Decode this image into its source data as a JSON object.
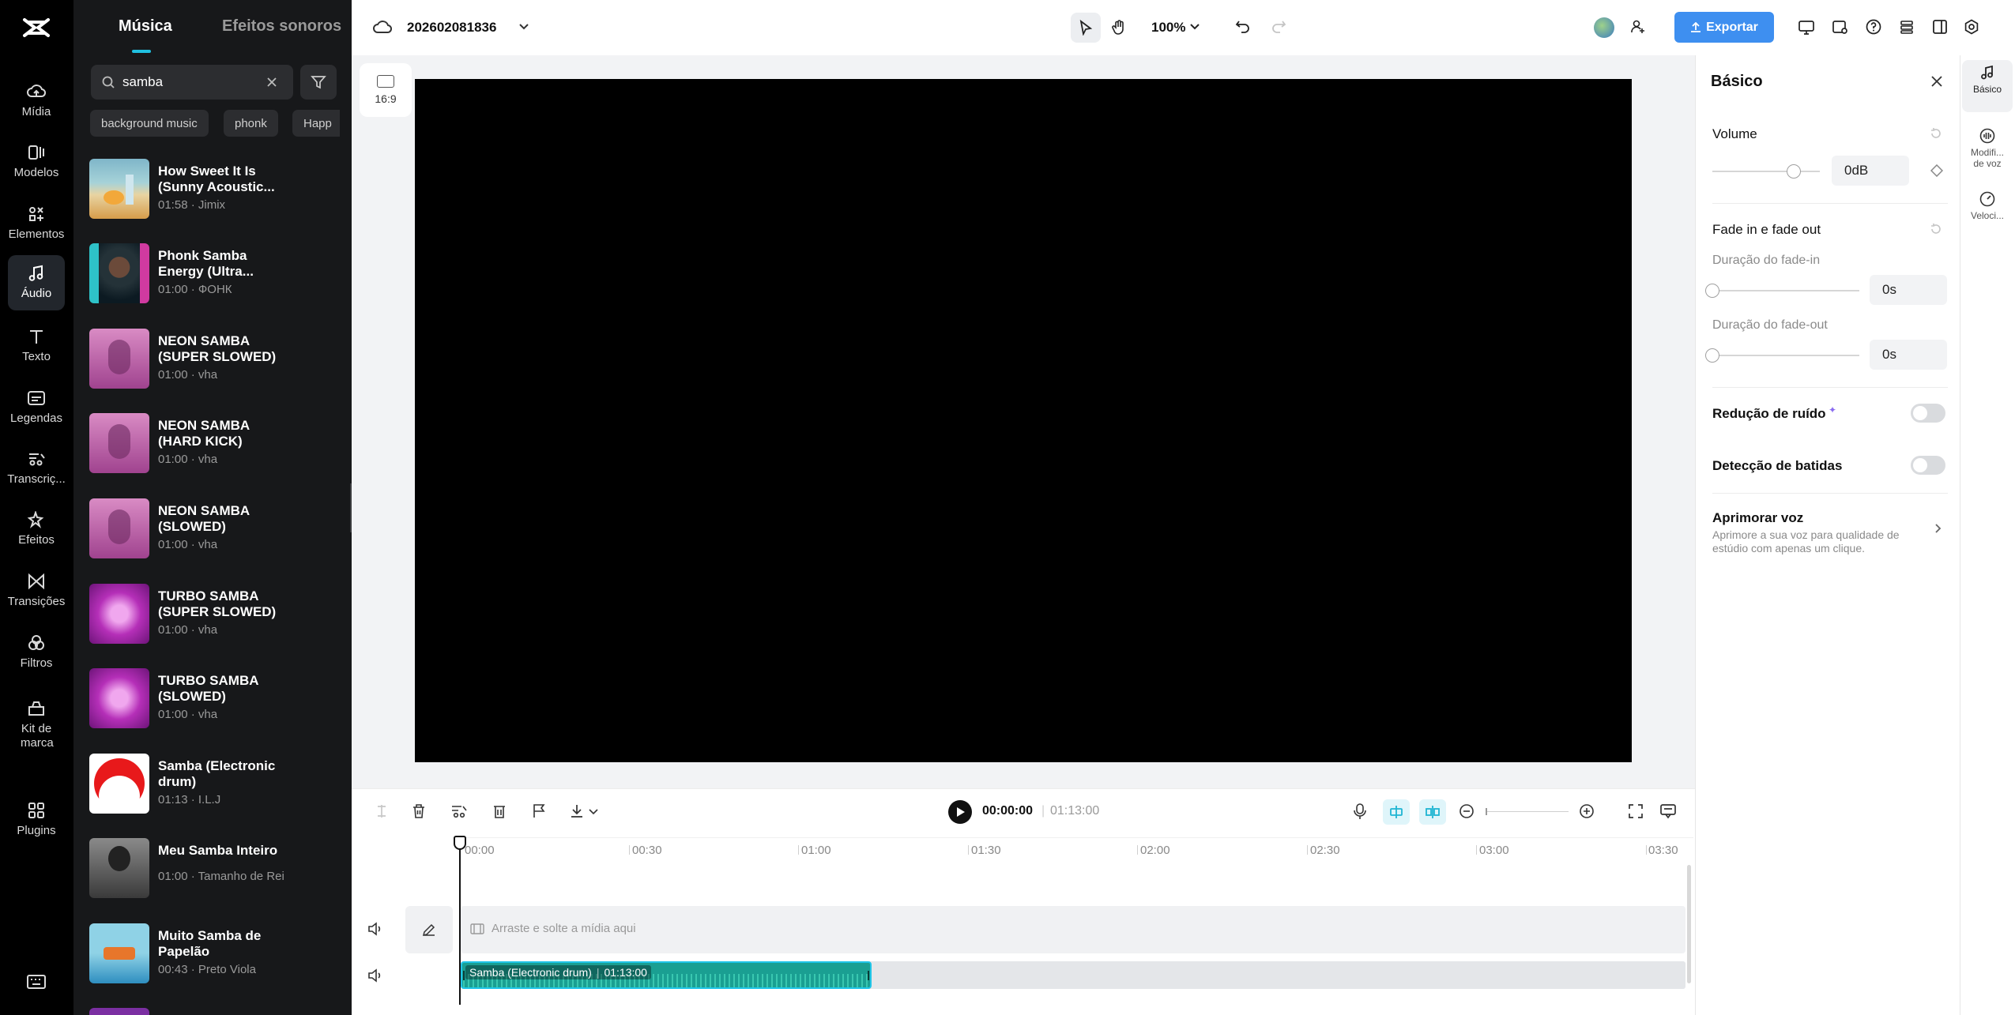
{
  "rail": {
    "items": [
      {
        "label": "Mídia",
        "icon": "cloud-upload-icon"
      },
      {
        "label": "Modelos",
        "icon": "template-icon"
      },
      {
        "label": "Elementos",
        "icon": "elements-icon"
      },
      {
        "label": "Áudio",
        "icon": "music-note-icon",
        "active": true
      },
      {
        "label": "Texto",
        "icon": "text-icon"
      },
      {
        "label": "Legendas",
        "icon": "captions-icon"
      },
      {
        "label": "Transcriç...",
        "icon": "transcript-icon"
      },
      {
        "label": "Efeitos",
        "icon": "effects-icon"
      },
      {
        "label": "Transições",
        "icon": "transitions-icon"
      },
      {
        "label": "Filtros",
        "icon": "filters-icon"
      },
      {
        "label": "Kit de marca",
        "icon": "brand-kit-icon"
      },
      {
        "label": "Plugins",
        "icon": "plugins-icon"
      }
    ]
  },
  "panel": {
    "tab_music": "Música",
    "tab_sfx": "Efeitos sonoros",
    "search_value": "samba",
    "chips": [
      "background music",
      "phonk",
      "Happ"
    ],
    "tracks": [
      {
        "title": "How Sweet It Is (Sunny Acoustic...",
        "meta": "01:58 · Jimix"
      },
      {
        "title": "Phonk Samba Energy (Ultra...",
        "meta": "01:00 · ФОНК"
      },
      {
        "title": "NEON SAMBA (SUPER SLOWED)",
        "meta": "01:00 · vha"
      },
      {
        "title": "NEON SAMBA (HARD KICK)",
        "meta": "01:00 · vha"
      },
      {
        "title": "NEON SAMBA (SLOWED)",
        "meta": "01:00 · vha"
      },
      {
        "title": "TURBO SAMBA (SUPER SLOWED)",
        "meta": "01:00 · vha"
      },
      {
        "title": "TURBO SAMBA (SLOWED)",
        "meta": "01:00 · vha"
      },
      {
        "title": "Samba (Electronic drum)",
        "meta": "01:13 · I.L.J"
      },
      {
        "title": "Meu Samba Inteiro",
        "meta": "01:00 · Tamanho de Rei"
      },
      {
        "title": "Muito Samba de Papelão",
        "meta": "00:43 · Preto Viola"
      }
    ]
  },
  "topbar": {
    "project_name": "202602081836",
    "zoom": "100%",
    "export_label": "Exportar"
  },
  "canvas": {
    "ratio": "16:9"
  },
  "props": {
    "title": "Básico",
    "volume_label": "Volume",
    "volume_value": "0dB",
    "volume_level": 0.76,
    "fade_label": "Fade in e fade out",
    "fade_in_label": "Duração do fade-in",
    "fade_in_value": "0s",
    "fade_out_label": "Duração do fade-out",
    "fade_out_value": "0s",
    "noise_label": "Redução de ruído",
    "beats_label": "Detecção de batidas",
    "enhance_title": "Aprimorar voz",
    "enhance_desc": "Aprimore a sua voz para qualidade de estúdio com apenas um clique."
  },
  "prop_tabs": [
    {
      "label": "Básico",
      "active": true
    },
    {
      "label": "Modifi... de voz"
    },
    {
      "label": "Veloci..."
    }
  ],
  "timeline": {
    "current_time": "00:00:00",
    "total_time": "01:13:00",
    "ruler": [
      "00:00",
      "00:30",
      "01:00",
      "01:30",
      "02:00",
      "02:30",
      "03:00",
      "03:30"
    ],
    "drop_hint": "Arraste e solte a mídia aqui",
    "clip_name": "Samba (Electronic drum)",
    "clip_duration": "01:13:00"
  }
}
